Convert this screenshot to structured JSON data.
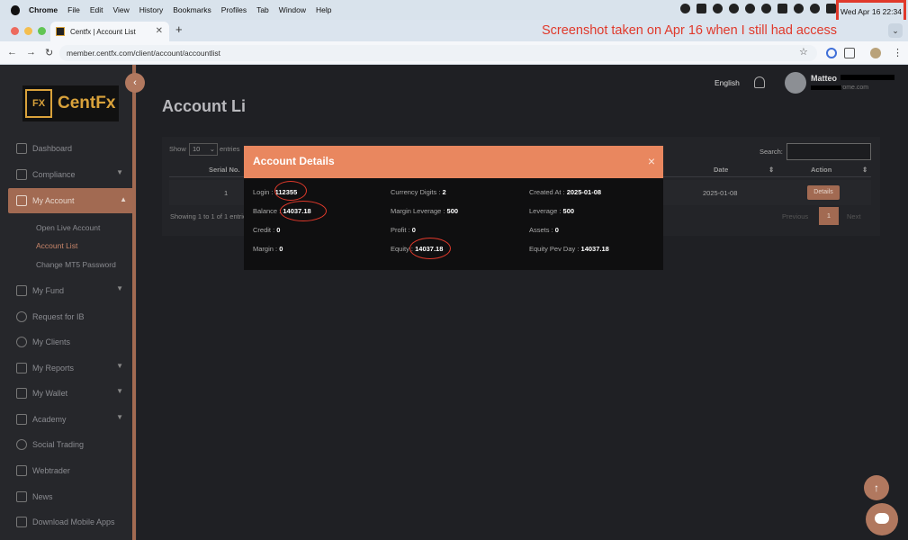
{
  "menubar": {
    "app": "Chrome",
    "items": [
      "File",
      "Edit",
      "View",
      "History",
      "Bookmarks",
      "Profiles",
      "Tab",
      "Window",
      "Help"
    ],
    "clock": "Wed Apr 16  22:34"
  },
  "browser": {
    "tab_title": "Centfx | Account List",
    "url": "member.centfx.com/client/account/accountlist",
    "annotation": "Screenshot taken on Apr 16 when I still had access"
  },
  "sidebar": {
    "logo_mark": "FX",
    "logo_text": "CentFx",
    "items": [
      {
        "label": "Dashboard",
        "icon": "dashboard-icon"
      },
      {
        "label": "Compliance",
        "icon": "document-icon"
      },
      {
        "label": "My Account",
        "icon": "account-icon"
      },
      {
        "label": "My Fund",
        "icon": "fund-icon"
      },
      {
        "label": "Request for IB",
        "icon": "ib-icon"
      },
      {
        "label": "My Clients",
        "icon": "clients-icon"
      },
      {
        "label": "My Reports",
        "icon": "chart-icon"
      },
      {
        "label": "My Wallet",
        "icon": "wallet-icon"
      },
      {
        "label": "Academy",
        "icon": "academy-icon"
      },
      {
        "label": "Social Trading",
        "icon": "social-icon"
      },
      {
        "label": "Webtrader",
        "icon": "webtrader-icon"
      },
      {
        "label": "News",
        "icon": "news-icon"
      },
      {
        "label": "Download Mobile Apps",
        "icon": "mobile-icon"
      }
    ],
    "subitems": [
      "Open Live Account",
      "Account List",
      "Change MT5 Password"
    ]
  },
  "header": {
    "title": "Account Li",
    "language": "English",
    "user_name": "Matteo",
    "user_email_suffix": "rome.com"
  },
  "table": {
    "show_label": "Show",
    "page_size": "10",
    "entries_label": "entries",
    "search_label": "Search:",
    "columns": [
      "Serial No.",
      "Date",
      "Action"
    ],
    "row": {
      "serial": "1",
      "date": "2025-01-08",
      "action": "Details"
    },
    "showing": "Showing 1 to 1 of 1 entries",
    "previous": "Previous",
    "current_page": "1",
    "next": "Next"
  },
  "modal": {
    "title": "Account Details",
    "close": "×",
    "fields": {
      "login": {
        "label": "Login :",
        "value": "112355"
      },
      "balance": {
        "label": "Balance :",
        "value": "14037.18"
      },
      "credit": {
        "label": "Credit :",
        "value": "0"
      },
      "margin": {
        "label": "Margin :",
        "value": "0"
      },
      "currency_digits": {
        "label": "Currency Digits :",
        "value": "2"
      },
      "margin_leverage": {
        "label": "Margin Leverage :",
        "value": "500"
      },
      "profit": {
        "label": "Profit :",
        "value": "0"
      },
      "equity": {
        "label": "Equity :",
        "value": "14037.18"
      },
      "created_at": {
        "label": "Created At :",
        "value": "2025-01-08"
      },
      "leverage": {
        "label": "Leverage :",
        "value": "500"
      },
      "assets": {
        "label": "Assets :",
        "value": "0"
      },
      "equity_prev_day": {
        "label": "Equity Pev Day :",
        "value": "14037.18"
      }
    }
  },
  "colors": {
    "accent": "#a26a52",
    "modal_header": "#e9875f",
    "annotation": "#e0392b"
  }
}
